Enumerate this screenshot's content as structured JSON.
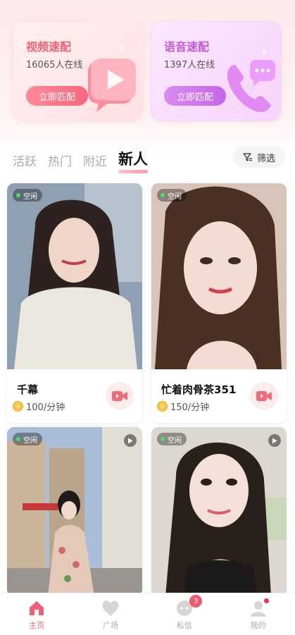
{
  "match_cards": {
    "video": {
      "title": "视频速配",
      "online": "16065人在线",
      "button": "立即匹配"
    },
    "voice": {
      "title": "语音速配",
      "online": "1397人在线",
      "button": "立即匹配"
    }
  },
  "tabs": [
    {
      "label": "活跃",
      "active": false
    },
    {
      "label": "热门",
      "active": false
    },
    {
      "label": "附近",
      "active": false
    },
    {
      "label": "新人",
      "active": true
    }
  ],
  "filter": {
    "label": "筛选",
    "icon": "filter-icon"
  },
  "users": [
    {
      "name": "千幕",
      "price": "100/分钟",
      "status": "空闲",
      "photo_colors": [
        "#8a9bb0",
        "#e8e3da"
      ]
    },
    {
      "name": "忙着肉骨茶351",
      "price": "150/分钟",
      "status": "空闲",
      "photo_colors": [
        "#5a3e2b",
        "#e9cfc1"
      ]
    },
    {
      "name": "",
      "price": "",
      "status": "空闲",
      "photo_colors": [
        "#c9b8a0",
        "#9fb6d4"
      ]
    },
    {
      "name": "",
      "price": "",
      "status": "空闲",
      "photo_colors": [
        "#d8d2cc",
        "#2b2420"
      ]
    }
  ],
  "bottom_nav": [
    {
      "label": "主页",
      "icon": "home-icon",
      "active": true
    },
    {
      "label": "广场",
      "icon": "heart-icon",
      "active": false
    },
    {
      "label": "私信",
      "icon": "chat-icon",
      "active": false,
      "badge": "3"
    },
    {
      "label": "我的",
      "icon": "profile-icon",
      "active": false,
      "dot": true
    }
  ],
  "colors": {
    "accent": "#f0607a",
    "voice_accent": "#c05ad8",
    "online_dot": "#4cd964"
  }
}
